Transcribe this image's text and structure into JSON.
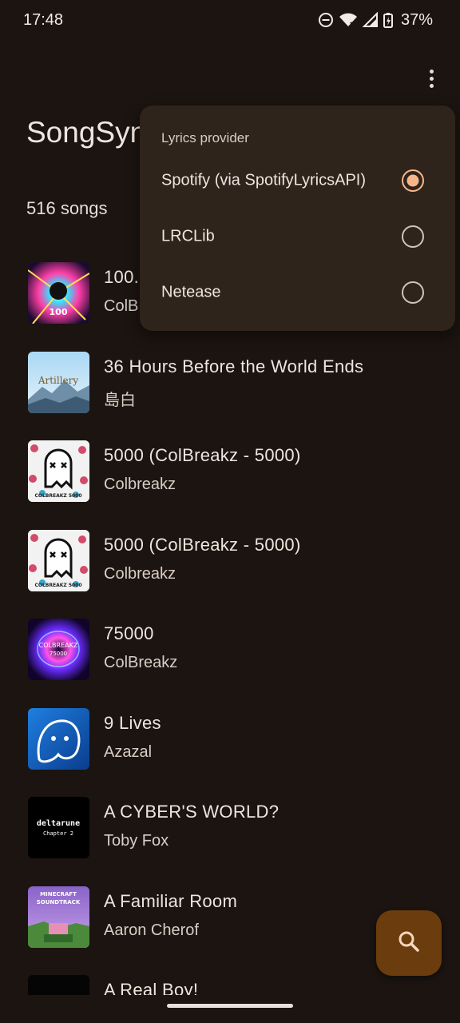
{
  "status": {
    "time": "17:48",
    "battery": "37%",
    "icons": [
      "do-not-disturb-icon",
      "wifi-icon",
      "signal-icon",
      "battery-charging-icon"
    ]
  },
  "app": {
    "title": "SongSync",
    "song_count": "516 songs"
  },
  "menu": {
    "header": "Lyrics provider",
    "options": [
      {
        "label": "Spotify (via SpotifyLyricsAPI)",
        "selected": true
      },
      {
        "label": "LRCLib",
        "selected": false
      },
      {
        "label": "Netease",
        "selected": false
      }
    ]
  },
  "songs": [
    {
      "title": "100.",
      "artist": "ColB",
      "art": "neon-burst"
    },
    {
      "title": "36 Hours Before the World Ends",
      "artist": "島白",
      "art": "mountain-sky"
    },
    {
      "title": "5000 (ColBreakz - 5000)",
      "artist": "Colbreakz",
      "art": "ghost-white"
    },
    {
      "title": "5000 (ColBreakz - 5000)",
      "artist": "Colbreakz",
      "art": "ghost-white"
    },
    {
      "title": "75000",
      "artist": "ColBreakz",
      "art": "purple-vortex"
    },
    {
      "title": "9 Lives",
      "artist": "Azazal",
      "art": "blue-ghost"
    },
    {
      "title": "A CYBER'S WORLD?",
      "artist": "Toby Fox",
      "art": "deltarune"
    },
    {
      "title": "A Familiar Room",
      "artist": "Aaron Cherof",
      "art": "minecraft-soundtrack"
    },
    {
      "title": "A Real Boy!",
      "artist": "",
      "art": "dark"
    }
  ],
  "art_text": {
    "neon-burst": "100",
    "mountain-sky": "Artillery",
    "ghost-white": "COLBREAKZ\n5000",
    "purple-vortex": "COLBREAKZ\n75000",
    "deltarune": "deltarune\nChapter 2",
    "minecraft-soundtrack": "MINECRAFT\nSOUNDTRACK"
  },
  "accent": "#f7b68a",
  "fab": {
    "icon": "search-icon",
    "color": "#6b3c0d"
  }
}
